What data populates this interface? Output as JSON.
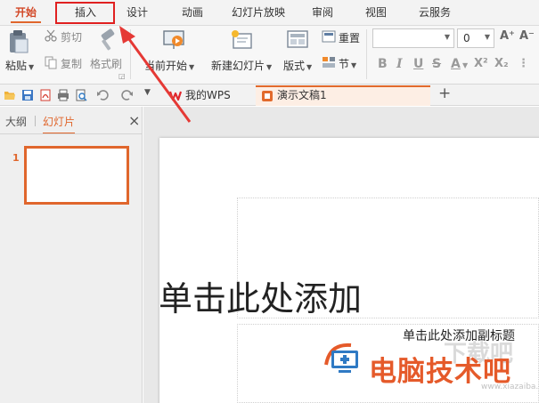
{
  "menu": {
    "tabs": [
      "开始",
      "插入",
      "设计",
      "动画",
      "幻灯片放映",
      "审阅",
      "视图",
      "云服务"
    ],
    "active": "开始",
    "highlighted": "插入"
  },
  "ribbon": {
    "paste_label": "粘贴",
    "cut_label": "剪切",
    "copy_label": "复制",
    "format_painter_label": "格式刷",
    "from_current_label": "当前开始",
    "new_slide_label": "新建幻灯片",
    "layout_label": "版式",
    "reset_label": "重置",
    "section_label": "节",
    "font_name_value": "",
    "font_size_value": "0",
    "grow_font": "A⁺",
    "shrink_font": "A⁻",
    "bold": "B",
    "italic": "I",
    "underline": "U",
    "strike": "S",
    "font_color": "A",
    "superscript": "X²",
    "subscript": "X₂"
  },
  "quickbar": {
    "tabs": [
      {
        "label": "我的WPS",
        "icon": "wps-logo-icon"
      },
      {
        "label": "演示文稿1",
        "icon": "presentation-doc-icon"
      }
    ],
    "add_tab": "+"
  },
  "left_panel": {
    "tab_outline": "大纲",
    "tab_slides": "幻灯片",
    "close": "×",
    "slide_number": "1"
  },
  "slide": {
    "title_placeholder": "单击此处添加",
    "subtitle_placeholder": "单击此处添加副标题"
  },
  "watermark": {
    "brand_text": "电脑技术吧",
    "faint_text": "下载吧",
    "url": "www.xiazaiba.com"
  },
  "colors": {
    "accent": "#e0662c",
    "highlight_box": "#e02020",
    "annotation_arrow": "#e53935",
    "watermark": "#e55a2a"
  }
}
